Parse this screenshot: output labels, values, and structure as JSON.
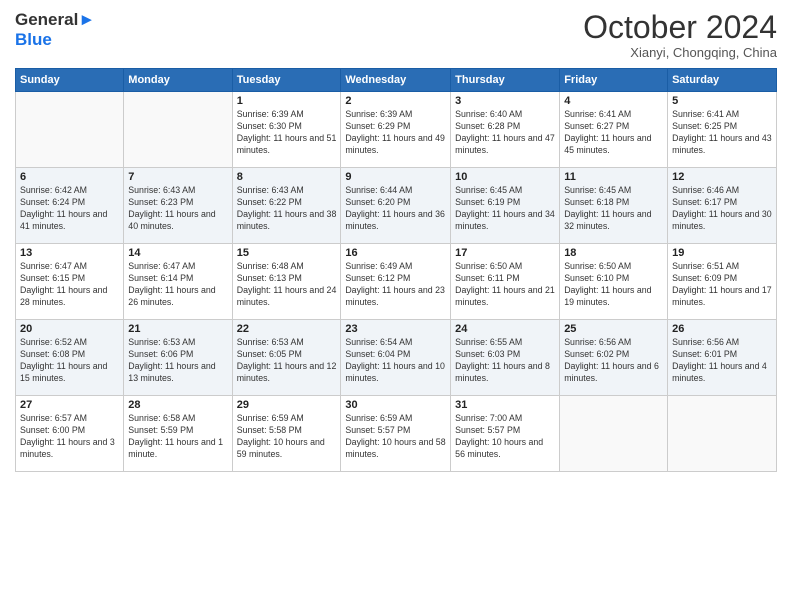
{
  "logo": {
    "line1": "General",
    "line2": "Blue"
  },
  "title": "October 2024",
  "subtitle": "Xianyi, Chongqing, China",
  "days_of_week": [
    "Sunday",
    "Monday",
    "Tuesday",
    "Wednesday",
    "Thursday",
    "Friday",
    "Saturday"
  ],
  "weeks": [
    [
      {
        "day": "",
        "sunrise": "",
        "sunset": "",
        "daylight": ""
      },
      {
        "day": "",
        "sunrise": "",
        "sunset": "",
        "daylight": ""
      },
      {
        "day": "1",
        "sunrise": "Sunrise: 6:39 AM",
        "sunset": "Sunset: 6:30 PM",
        "daylight": "Daylight: 11 hours and 51 minutes."
      },
      {
        "day": "2",
        "sunrise": "Sunrise: 6:39 AM",
        "sunset": "Sunset: 6:29 PM",
        "daylight": "Daylight: 11 hours and 49 minutes."
      },
      {
        "day": "3",
        "sunrise": "Sunrise: 6:40 AM",
        "sunset": "Sunset: 6:28 PM",
        "daylight": "Daylight: 11 hours and 47 minutes."
      },
      {
        "day": "4",
        "sunrise": "Sunrise: 6:41 AM",
        "sunset": "Sunset: 6:27 PM",
        "daylight": "Daylight: 11 hours and 45 minutes."
      },
      {
        "day": "5",
        "sunrise": "Sunrise: 6:41 AM",
        "sunset": "Sunset: 6:25 PM",
        "daylight": "Daylight: 11 hours and 43 minutes."
      }
    ],
    [
      {
        "day": "6",
        "sunrise": "Sunrise: 6:42 AM",
        "sunset": "Sunset: 6:24 PM",
        "daylight": "Daylight: 11 hours and 41 minutes."
      },
      {
        "day": "7",
        "sunrise": "Sunrise: 6:43 AM",
        "sunset": "Sunset: 6:23 PM",
        "daylight": "Daylight: 11 hours and 40 minutes."
      },
      {
        "day": "8",
        "sunrise": "Sunrise: 6:43 AM",
        "sunset": "Sunset: 6:22 PM",
        "daylight": "Daylight: 11 hours and 38 minutes."
      },
      {
        "day": "9",
        "sunrise": "Sunrise: 6:44 AM",
        "sunset": "Sunset: 6:20 PM",
        "daylight": "Daylight: 11 hours and 36 minutes."
      },
      {
        "day": "10",
        "sunrise": "Sunrise: 6:45 AM",
        "sunset": "Sunset: 6:19 PM",
        "daylight": "Daylight: 11 hours and 34 minutes."
      },
      {
        "day": "11",
        "sunrise": "Sunrise: 6:45 AM",
        "sunset": "Sunset: 6:18 PM",
        "daylight": "Daylight: 11 hours and 32 minutes."
      },
      {
        "day": "12",
        "sunrise": "Sunrise: 6:46 AM",
        "sunset": "Sunset: 6:17 PM",
        "daylight": "Daylight: 11 hours and 30 minutes."
      }
    ],
    [
      {
        "day": "13",
        "sunrise": "Sunrise: 6:47 AM",
        "sunset": "Sunset: 6:15 PM",
        "daylight": "Daylight: 11 hours and 28 minutes."
      },
      {
        "day": "14",
        "sunrise": "Sunrise: 6:47 AM",
        "sunset": "Sunset: 6:14 PM",
        "daylight": "Daylight: 11 hours and 26 minutes."
      },
      {
        "day": "15",
        "sunrise": "Sunrise: 6:48 AM",
        "sunset": "Sunset: 6:13 PM",
        "daylight": "Daylight: 11 hours and 24 minutes."
      },
      {
        "day": "16",
        "sunrise": "Sunrise: 6:49 AM",
        "sunset": "Sunset: 6:12 PM",
        "daylight": "Daylight: 11 hours and 23 minutes."
      },
      {
        "day": "17",
        "sunrise": "Sunrise: 6:50 AM",
        "sunset": "Sunset: 6:11 PM",
        "daylight": "Daylight: 11 hours and 21 minutes."
      },
      {
        "day": "18",
        "sunrise": "Sunrise: 6:50 AM",
        "sunset": "Sunset: 6:10 PM",
        "daylight": "Daylight: 11 hours and 19 minutes."
      },
      {
        "day": "19",
        "sunrise": "Sunrise: 6:51 AM",
        "sunset": "Sunset: 6:09 PM",
        "daylight": "Daylight: 11 hours and 17 minutes."
      }
    ],
    [
      {
        "day": "20",
        "sunrise": "Sunrise: 6:52 AM",
        "sunset": "Sunset: 6:08 PM",
        "daylight": "Daylight: 11 hours and 15 minutes."
      },
      {
        "day": "21",
        "sunrise": "Sunrise: 6:53 AM",
        "sunset": "Sunset: 6:06 PM",
        "daylight": "Daylight: 11 hours and 13 minutes."
      },
      {
        "day": "22",
        "sunrise": "Sunrise: 6:53 AM",
        "sunset": "Sunset: 6:05 PM",
        "daylight": "Daylight: 11 hours and 12 minutes."
      },
      {
        "day": "23",
        "sunrise": "Sunrise: 6:54 AM",
        "sunset": "Sunset: 6:04 PM",
        "daylight": "Daylight: 11 hours and 10 minutes."
      },
      {
        "day": "24",
        "sunrise": "Sunrise: 6:55 AM",
        "sunset": "Sunset: 6:03 PM",
        "daylight": "Daylight: 11 hours and 8 minutes."
      },
      {
        "day": "25",
        "sunrise": "Sunrise: 6:56 AM",
        "sunset": "Sunset: 6:02 PM",
        "daylight": "Daylight: 11 hours and 6 minutes."
      },
      {
        "day": "26",
        "sunrise": "Sunrise: 6:56 AM",
        "sunset": "Sunset: 6:01 PM",
        "daylight": "Daylight: 11 hours and 4 minutes."
      }
    ],
    [
      {
        "day": "27",
        "sunrise": "Sunrise: 6:57 AM",
        "sunset": "Sunset: 6:00 PM",
        "daylight": "Daylight: 11 hours and 3 minutes."
      },
      {
        "day": "28",
        "sunrise": "Sunrise: 6:58 AM",
        "sunset": "Sunset: 5:59 PM",
        "daylight": "Daylight: 11 hours and 1 minute."
      },
      {
        "day": "29",
        "sunrise": "Sunrise: 6:59 AM",
        "sunset": "Sunset: 5:58 PM",
        "daylight": "Daylight: 10 hours and 59 minutes."
      },
      {
        "day": "30",
        "sunrise": "Sunrise: 6:59 AM",
        "sunset": "Sunset: 5:57 PM",
        "daylight": "Daylight: 10 hours and 58 minutes."
      },
      {
        "day": "31",
        "sunrise": "Sunrise: 7:00 AM",
        "sunset": "Sunset: 5:57 PM",
        "daylight": "Daylight: 10 hours and 56 minutes."
      },
      {
        "day": "",
        "sunrise": "",
        "sunset": "",
        "daylight": ""
      },
      {
        "day": "",
        "sunrise": "",
        "sunset": "",
        "daylight": ""
      }
    ]
  ]
}
